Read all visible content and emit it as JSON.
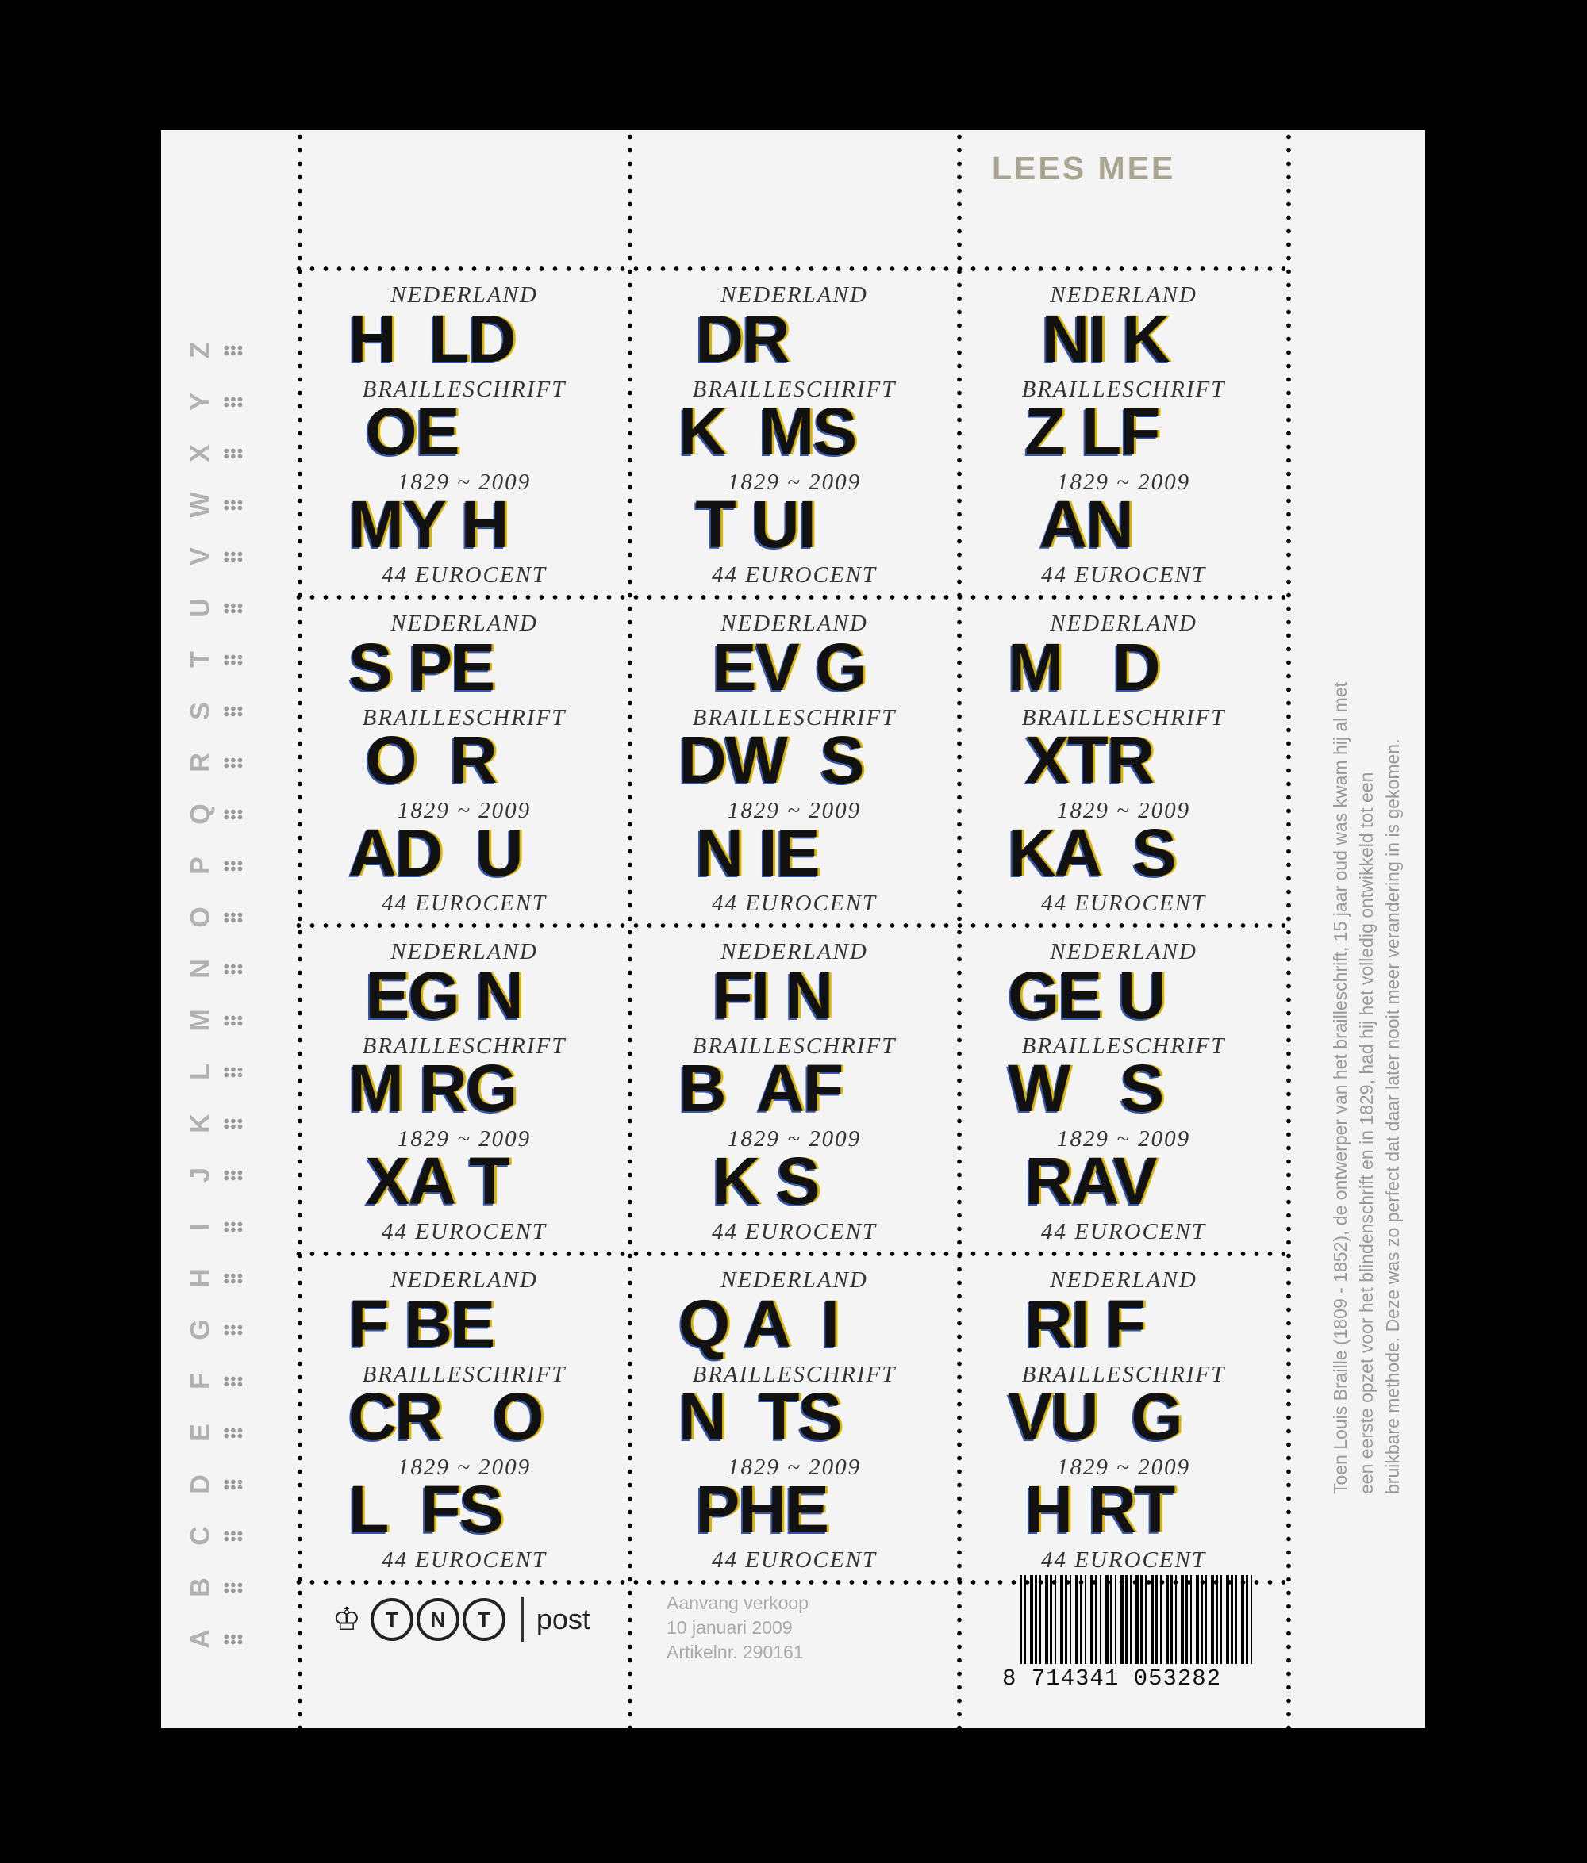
{
  "header": {
    "lees_mee": "LEES MEE"
  },
  "alphabet": [
    "A",
    "B",
    "C",
    "D",
    "E",
    "F",
    "G",
    "H",
    "I",
    "J",
    "K",
    "L",
    "M",
    "N",
    "O",
    "P",
    "Q",
    "R",
    "S",
    "T",
    "U",
    "V",
    "W",
    "X",
    "Y",
    "Z"
  ],
  "stamp_text": {
    "country": "NEDERLAND",
    "subject": "BRAILLESCHRIFT",
    "years": "1829 ~ 2009",
    "value": "44 EUROCENT"
  },
  "stamps": [
    {
      "row1": "H  LD",
      "row2": " OE",
      "row3": "MY H"
    },
    {
      "row1": " DR",
      "row2": "K  MS",
      "row3": " T UI"
    },
    {
      "row1": "  NI K",
      "row2": " Z LF",
      "row3": "  AN"
    },
    {
      "row1": "S PE",
      "row2": " O  R",
      "row3": "AD  U"
    },
    {
      "row1": "  EV G",
      "row2": "DW  S",
      "row3": " N IE"
    },
    {
      "row1": "M   D",
      "row2": " XTR",
      "row3": "KA  S"
    },
    {
      "row1": " EG N",
      "row2": "M RG",
      "row3": " XA T"
    },
    {
      "row1": "  FI N",
      "row2": "B  AF",
      "row3": "  K S"
    },
    {
      "row1": "GE U",
      "row2": "W   S",
      "row3": " RAV"
    },
    {
      "row1": "F BE",
      "row2": "CR   O",
      "row3": "L  FS"
    },
    {
      "row1": "Q A  I",
      "row2": "N  TS",
      "row3": " PHE"
    },
    {
      "row1": " RI F",
      "row2": "VU  G",
      "row3": " H RT"
    }
  ],
  "side_text": {
    "line1": "Toen Louis Braille (1809 - 1852), de ontwerper van het brailleschrift, 15 jaar oud was kwam hij al met",
    "line2": "een eerste opzet voor het blindenschrift en in 1829, had hij het volledig ontwikkeld tot een",
    "line3": "bruikbare methode. Deze was zo perfect dat daar later nooit meer verandering in is gekomen."
  },
  "footer": {
    "crown": "♔",
    "tnt_letters": [
      "T",
      "N",
      "T"
    ],
    "post": "post",
    "sale_line1": "Aanvang verkoop",
    "sale_line2": "10 januari 2009",
    "sale_line3": "Artikelnr. 290161",
    "barcode": "8 714341 053282"
  }
}
